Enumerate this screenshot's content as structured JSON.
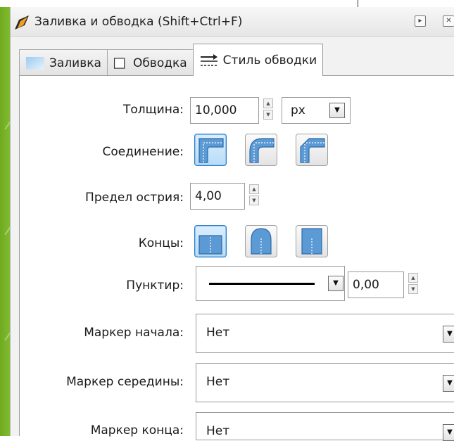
{
  "dialog": {
    "title": "Заливка и обводка (Shift+Ctrl+F)",
    "title_buttons": [
      "▸",
      "✕"
    ]
  },
  "tabs": [
    {
      "label": "Заливка",
      "icon": "fill-swatch-icon",
      "active": false
    },
    {
      "label": "Обводка",
      "icon": "stroke-swatch-icon",
      "active": false
    },
    {
      "label": "Стиль обводки",
      "icon": "stroke-style-icon",
      "active": true
    }
  ],
  "stroke_style": {
    "width_label": "Толщина:",
    "width_value": "10,000",
    "unit_value": "px",
    "join_label": "Соединение:",
    "join_options": [
      "miter-join",
      "round-join",
      "bevel-join"
    ],
    "join_selected": "miter-join",
    "miter_label": "Предел острия:",
    "miter_value": "4,00",
    "caps_label": "Концы:",
    "cap_options": [
      "butt-cap",
      "round-cap",
      "square-cap"
    ],
    "cap_selected": "butt-cap",
    "dash_label": "Пунктир:",
    "dash_offset_value": "0,00",
    "start_marker_label": "Маркер начала:",
    "start_marker_value": "Нет",
    "mid_marker_label": "Маркер середины:",
    "mid_marker_value": "Нет",
    "end_marker_label": "Маркер конца:",
    "end_marker_value": "Нет"
  },
  "colors": {
    "accent_pressed": "#2b7cc4",
    "slide_green": "#8cc63f"
  }
}
